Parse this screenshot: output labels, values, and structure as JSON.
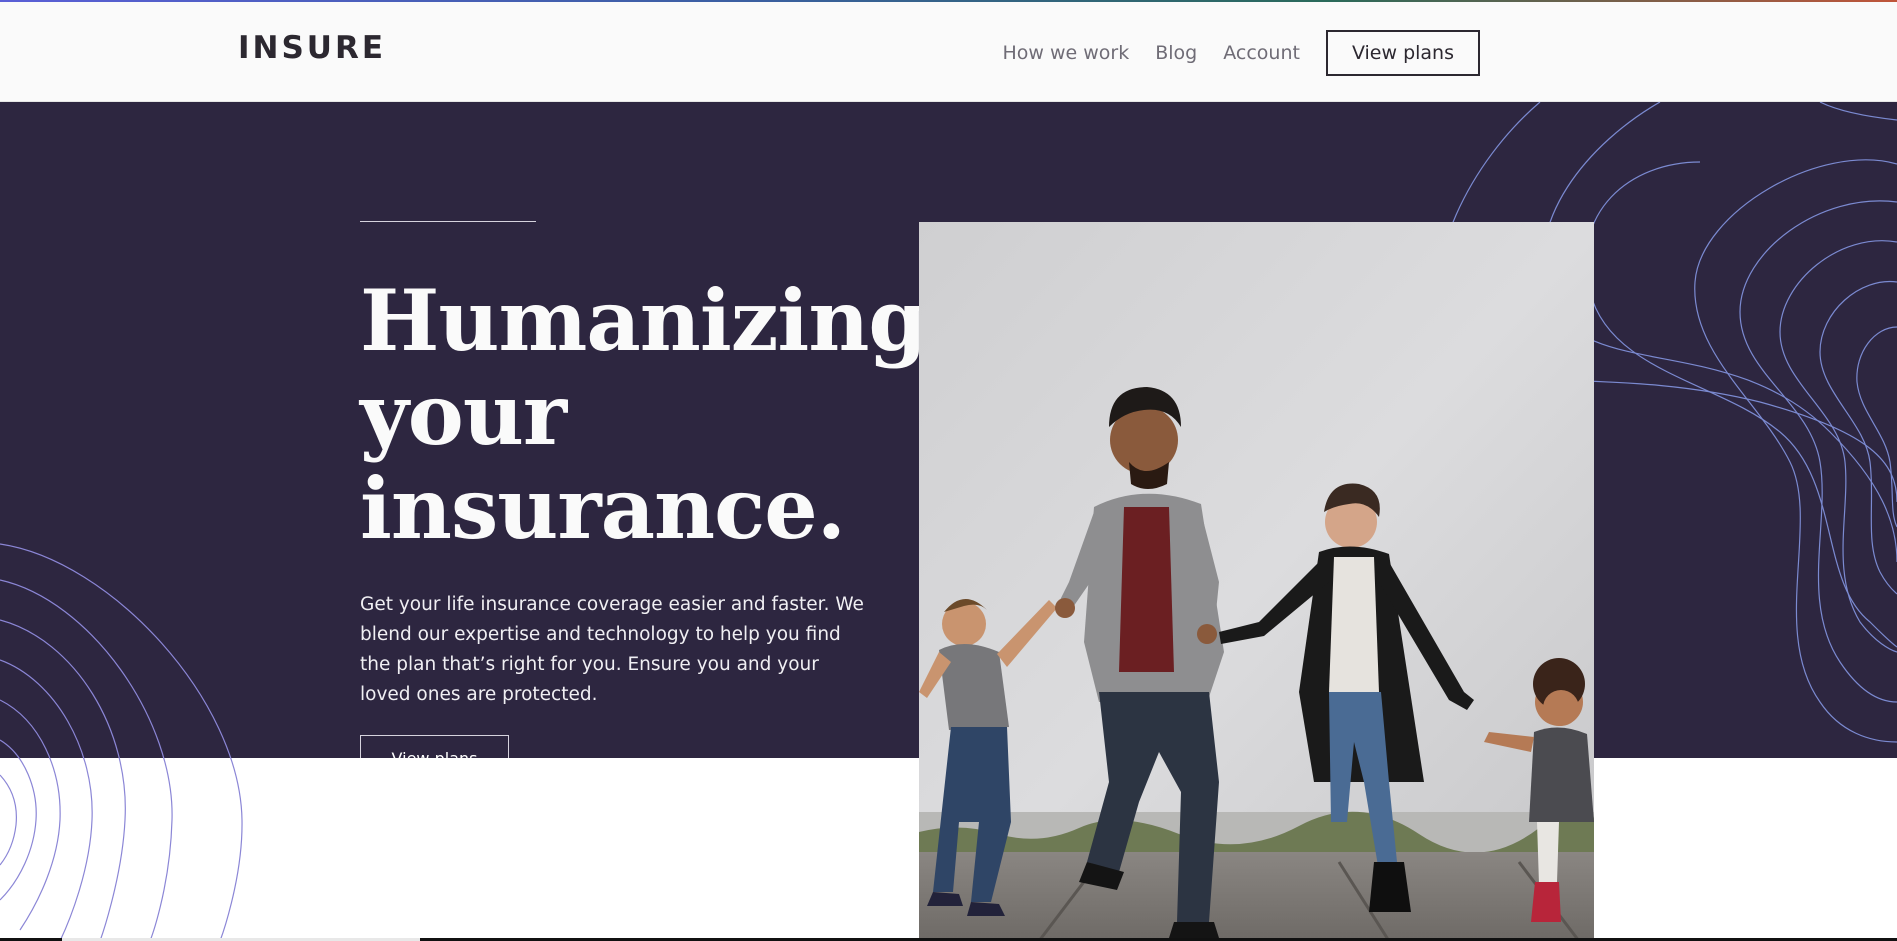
{
  "header": {
    "logo": "INSURE",
    "nav": [
      {
        "label": "How we work"
      },
      {
        "label": "Blog"
      },
      {
        "label": "Account"
      }
    ],
    "cta_label": "View plans"
  },
  "hero": {
    "title_lines": [
      "Humanizing",
      "your",
      "insurance."
    ],
    "description": "Get your life insurance coverage easier and faster. We blend our expertise and technology to help you find the plan that’s right for you. Ensure you and your loved ones are protected.",
    "cta_label": "View plans",
    "image_alt": "family holding hands walking on sidewalk"
  },
  "colors": {
    "hero_background": "#2d2640",
    "page_background": "#ffffff",
    "nav_background": "#fafafa",
    "decor_line": "#7b8ad1",
    "text_dark": "#2c2830",
    "nav_text": "#6f6c76"
  }
}
